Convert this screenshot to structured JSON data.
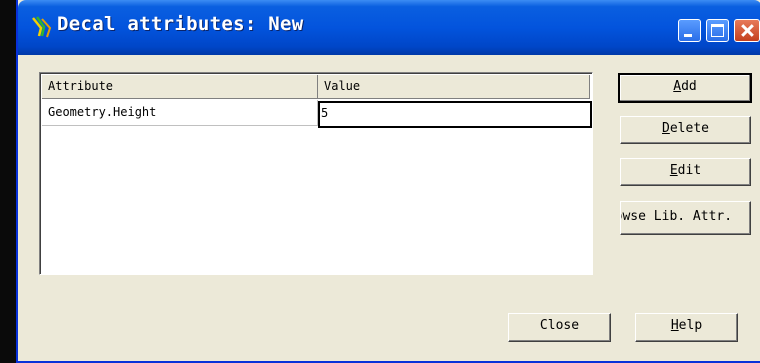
{
  "window": {
    "title": "Decal attributes: New",
    "app_icon": "app-logo-icon"
  },
  "grid": {
    "columns": [
      "Attribute",
      "Value"
    ],
    "rows": [
      {
        "attribute": "Geometry.Height",
        "value": "5"
      }
    ]
  },
  "buttons": {
    "add": {
      "mnemonic": "A",
      "rest": "dd"
    },
    "delete": {
      "mnemonic": "D",
      "rest": "elete"
    },
    "edit": {
      "mnemonic": "E",
      "rest": "dit"
    },
    "browse": "Browse Lib. Attr.",
    "close": "Close",
    "help": {
      "mnemonic": "H",
      "rest": "elp"
    }
  }
}
